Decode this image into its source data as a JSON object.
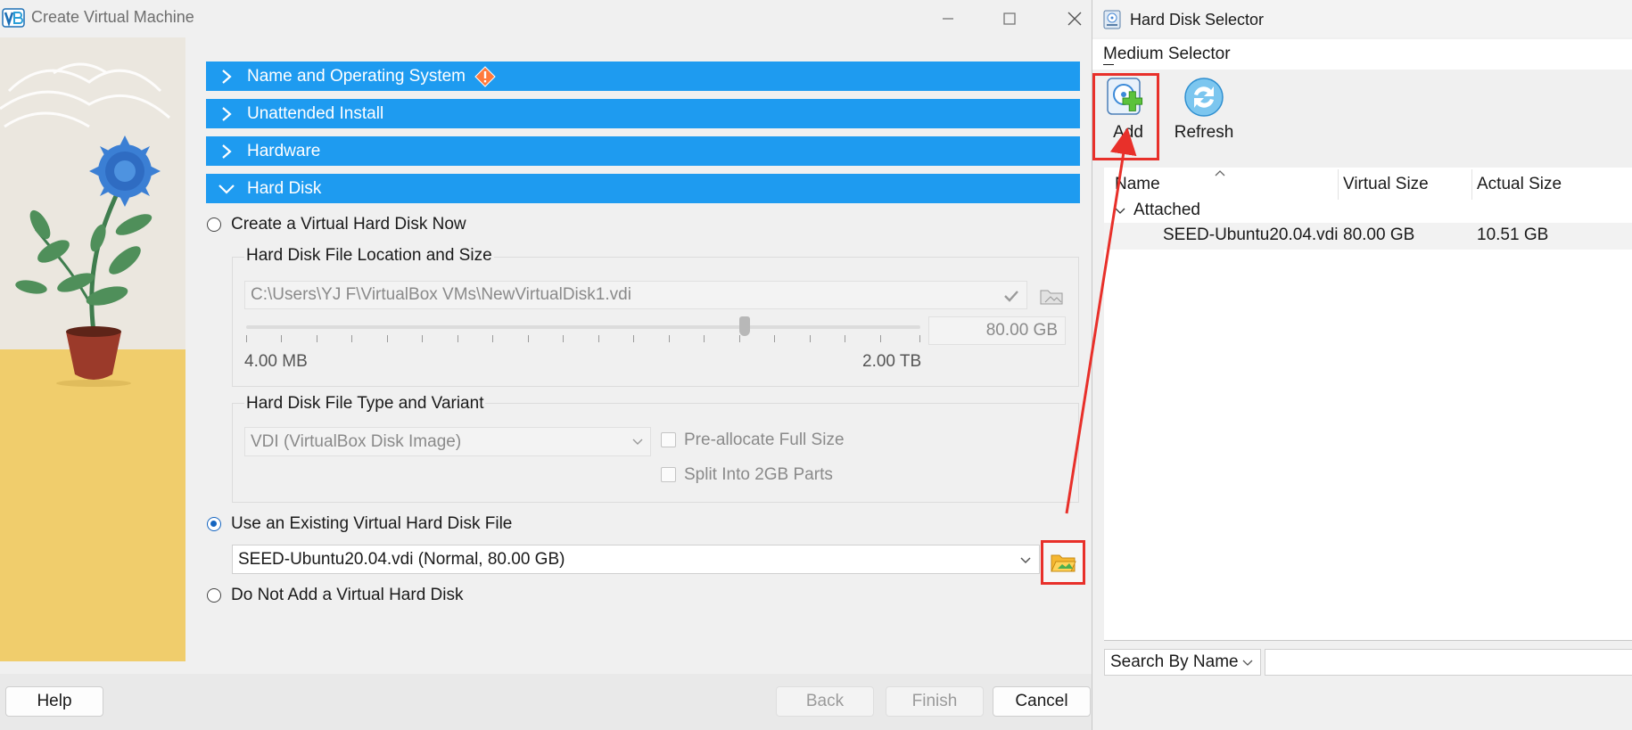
{
  "wizard": {
    "title": "Create Virtual Machine",
    "sections": [
      {
        "label": "Name and Operating System",
        "expanded": false,
        "warning": true
      },
      {
        "label": "Unattended Install",
        "expanded": false
      },
      {
        "label": "Hardware",
        "expanded": false
      },
      {
        "label": "Hard Disk",
        "expanded": true
      }
    ],
    "hard_disk": {
      "option_create": "Create a Virtual Hard Disk Now",
      "location_group": "Hard Disk File Location and Size",
      "file_path": "C:\\Users\\YJ F\\VirtualBox VMs\\NewVirtualDisk1.vdi",
      "size_value": "80.00 GB",
      "size_min": "4.00 MB",
      "size_max": "2.00 TB",
      "type_group": "Hard Disk File Type and Variant",
      "file_type": "VDI (VirtualBox Disk Image)",
      "preallocate": "Pre-allocate Full Size",
      "split": "Split Into 2GB Parts",
      "option_existing": "Use an Existing Virtual Hard Disk File",
      "existing_file": "SEED-Ubuntu20.04.vdi (Normal, 80.00 GB)",
      "option_none": "Do Not Add a Virtual Hard Disk",
      "selected_option": "existing"
    },
    "buttons": {
      "help": "Help",
      "back": "Back",
      "finish": "Finish",
      "cancel": "Cancel"
    }
  },
  "selector": {
    "title": "Hard Disk Selector",
    "menu": "Medium Selector",
    "toolbar": {
      "add": "Add",
      "refresh": "Refresh"
    },
    "columns": [
      "Name",
      "Virtual Size",
      "Actual Size"
    ],
    "group": "Attached",
    "rows": [
      {
        "name": "SEED-Ubuntu20.04.vdi",
        "virtual_size": "80.00 GB",
        "actual_size": "10.51 GB"
      }
    ],
    "search_mode": "Search By Name",
    "search_value": ""
  },
  "colors": {
    "section_header": "#1e9bf0",
    "highlight": "#e8302a",
    "radio_checked": "#1565c0"
  }
}
